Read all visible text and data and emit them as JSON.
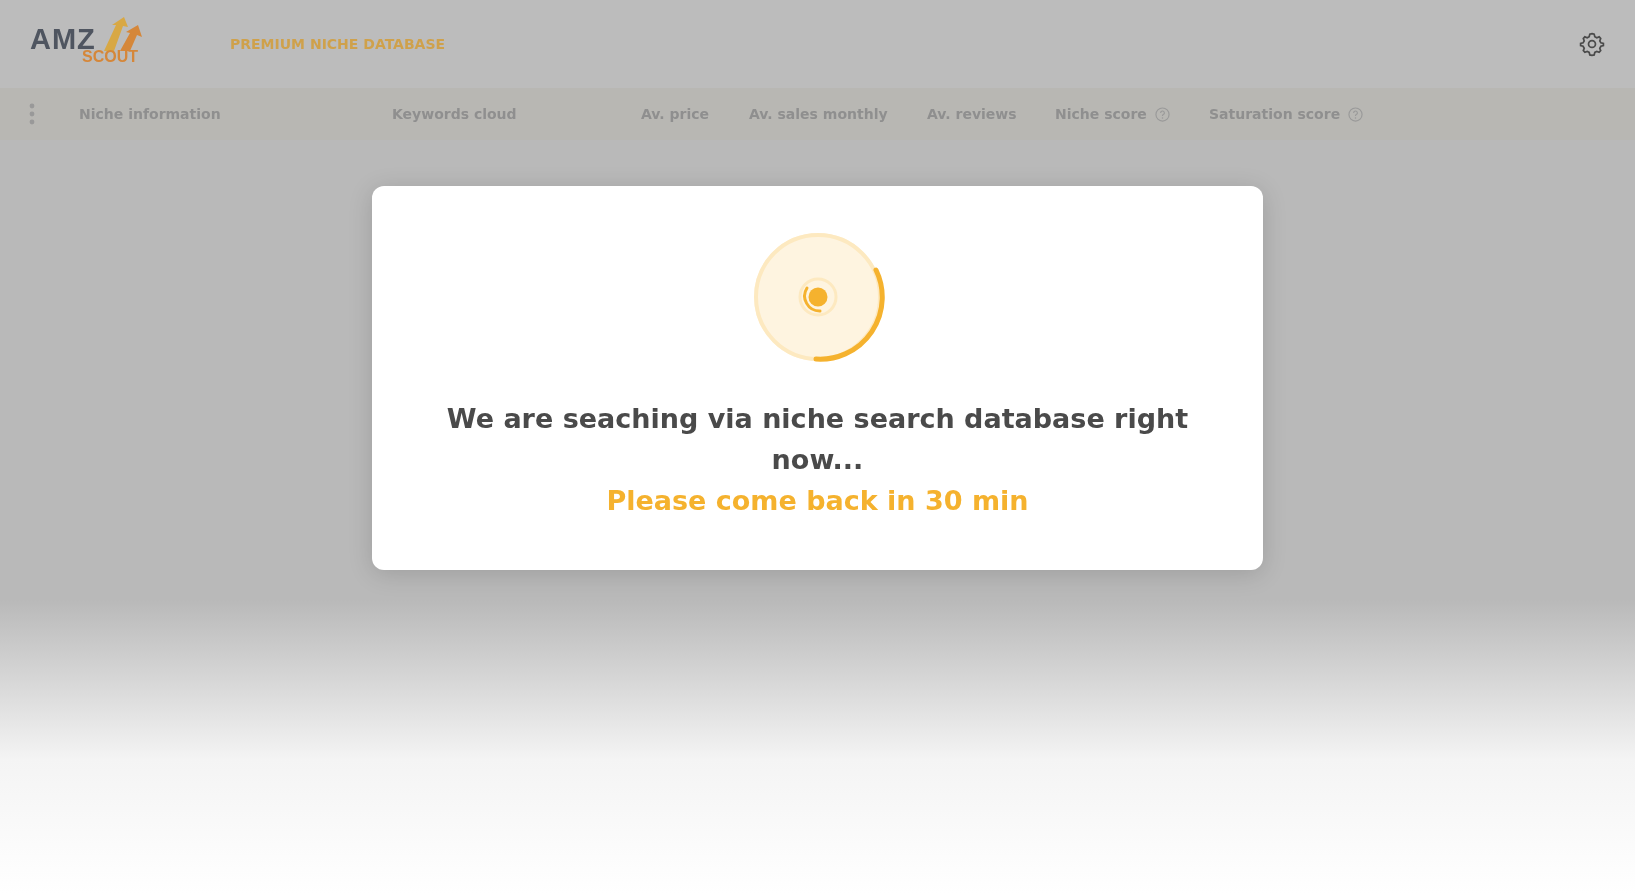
{
  "header": {
    "logo": {
      "top": "AMZ",
      "bottom": "SCOUT"
    },
    "title": "PREMIUM NICHE DATABASE"
  },
  "columns": [
    {
      "label": "Niche information",
      "help": false
    },
    {
      "label": "Keywords cloud",
      "help": false
    },
    {
      "label": "Av. price",
      "help": false
    },
    {
      "label": "Av. sales monthly",
      "help": false
    },
    {
      "label": "Av. reviews",
      "help": false
    },
    {
      "label": "Niche score",
      "help": true
    },
    {
      "label": "Saturation score",
      "help": true
    }
  ],
  "modal": {
    "message": "We are seaching via niche search database right now...",
    "note": "Please come back in 30 min"
  }
}
